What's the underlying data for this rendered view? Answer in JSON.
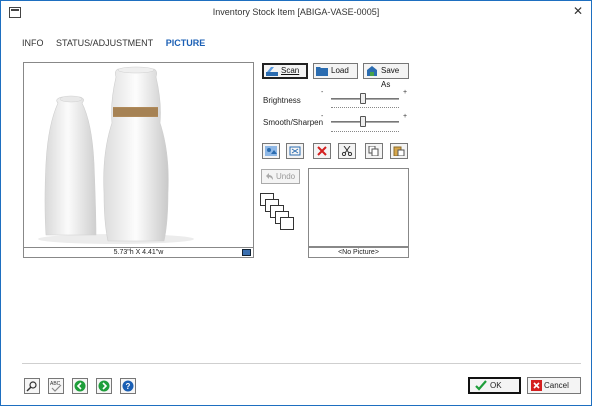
{
  "window": {
    "title": "Inventory Stock Item [ABIGA-VASE-0005]",
    "close_glyph": "✕"
  },
  "tabs": [
    {
      "label": "INFO",
      "active": false
    },
    {
      "label": "STATUS/ADJUSTMENT",
      "active": false
    },
    {
      "label": "PICTURE",
      "active": true
    }
  ],
  "picture": {
    "dimensions": "5.73\"h X 4.41\"w",
    "description_icon": "vase-photo"
  },
  "actions": {
    "scan_label": "Scan",
    "load_label": "Load",
    "save_as_label": "Save As"
  },
  "adjustments": {
    "brightness_label": "Brightness",
    "brightness_level": 0.5,
    "smooth_label": "Smooth/Sharpen",
    "smooth_level": 0.5,
    "minus": "-",
    "plus": "+"
  },
  "tools": [
    "auto-enhance-icon",
    "fit-icon",
    "delete-icon",
    "cut-icon",
    "copy-icon",
    "paste-icon"
  ],
  "undo_label": "Undo",
  "preview": {
    "label": "<No Picture>"
  },
  "footer": {
    "ok_label": "OK",
    "cancel_label": "Cancel"
  },
  "colors": {
    "accent": "#1a5fb4",
    "ok_green": "#1e9e3a",
    "cancel_red": "#d42020"
  }
}
